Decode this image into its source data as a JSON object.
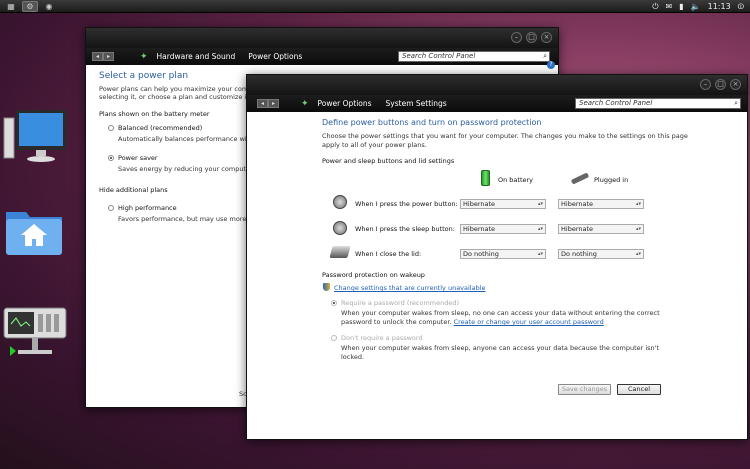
{
  "topbar": {
    "clock": "11:13"
  },
  "back_window": {
    "breadcrumb": [
      "Hardware and Sound",
      "Power Options"
    ],
    "search_placeholder": "Search Control Panel",
    "help": "?",
    "title": "Select a power plan",
    "intro1": "Power plans can help you maximize your compute",
    "intro2": "selecting it, or choose a plan and customize it by e",
    "section1": "Plans shown on the battery meter",
    "plans": [
      {
        "name": "Balanced (recommended)",
        "desc": "Automatically balances performance with"
      },
      {
        "name": "Power saver",
        "desc": "Saves energy by reducing your computer's"
      }
    ],
    "section2": "Hide additional plans",
    "hidden_plan": {
      "name": "High performance",
      "desc": "Favors performance, but may use more ene"
    },
    "footer_fragment": "Sc"
  },
  "front_window": {
    "breadcrumb": [
      "Power Options",
      "System Settings"
    ],
    "search_placeholder": "Search Control Panel",
    "heading": "Define power buttons and turn on password protection",
    "intro1": "Choose the power settings that you want for your computer. The changes you make to the settings on this page",
    "intro2": "apply to all of your power plans.",
    "section1": "Power and sleep buttons and lid settings",
    "col_battery": "On battery",
    "col_plugged": "Plugged in",
    "rows": [
      {
        "label": "When I press the power button:",
        "battery": "Hibernate",
        "plugged": "Hibernate"
      },
      {
        "label": "When I press the sleep button:",
        "battery": "Hibernate",
        "plugged": "Hibernate"
      },
      {
        "label": "When I close the lid:",
        "battery": "Do nothing",
        "plugged": "Do nothing"
      }
    ],
    "section2": "Password protection on wakeup",
    "change_link": "Change settings that are currently unavailable",
    "opt_require": "Require a password (recommended)",
    "require_desc1": "When your computer wakes from sleep, no one can access your data without entering the correct",
    "require_desc2_pre": "password to unlock the computer.",
    "require_link": "Create or change your user account password",
    "opt_norequire": "Don't require a password",
    "norequire_desc1": "When your computer wakes from sleep, anyone can access your data because the computer isn't",
    "norequire_desc2": "locked.",
    "save_btn": "Save changes",
    "cancel_btn": "Cancel"
  },
  "colors": {
    "heading": "#2a5d9f",
    "link": "#1f5fb4"
  }
}
